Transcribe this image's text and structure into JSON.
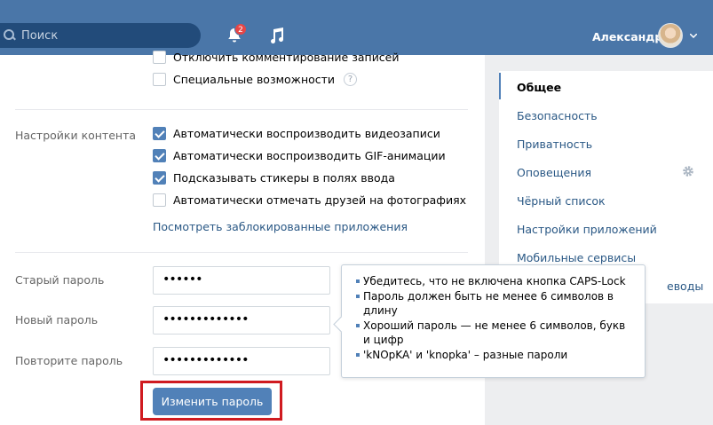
{
  "header": {
    "search_placeholder": "Поиск",
    "notifications_count": "2",
    "user_name": "Александр"
  },
  "privacy_options": [
    {
      "label": "Отключить комментирование записей",
      "checked": false
    },
    {
      "label": "Специальные возможности",
      "checked": false
    }
  ],
  "help_symbol": "?",
  "content_settings": {
    "title": "Настройки контента",
    "options": [
      {
        "label": "Автоматически воспроизводить видеозаписи",
        "checked": true
      },
      {
        "label": "Автоматически воспроизводить GIF-анимации",
        "checked": true
      },
      {
        "label": "Подсказывать стикеры в полях ввода",
        "checked": true
      },
      {
        "label": "Автоматически отмечать друзей на фотографиях",
        "checked": false
      }
    ],
    "blocked_apps_link": "Посмотреть заблокированные приложения"
  },
  "password": {
    "old_label": "Старый пароль",
    "old_value": "••••••",
    "new_label": "Новый пароль",
    "new_value": "•••••••••••••",
    "repeat_label": "Повторите пароль",
    "repeat_value": "•••••••••••••",
    "submit_label": "Изменить пароль"
  },
  "tooltip": {
    "tips": [
      "Убедитесь, что не включена кнопка CAPS-Lock",
      "Пароль должен быть не менее 6 символов в длину",
      "Хороший пароль — не менее 6 символов, букв и цифр",
      "'kNOpKA' и 'knopka' – разные пароли"
    ]
  },
  "menu": {
    "items": [
      {
        "label": "Общее",
        "active": true
      },
      {
        "label": "Безопасность"
      },
      {
        "label": "Приватность"
      },
      {
        "label": "Оповещения"
      },
      {
        "label": "Чёрный список"
      },
      {
        "label": "Настройки приложений"
      },
      {
        "label": "Мобильные сервисы"
      },
      {
        "label": "Платежи и переводы"
      }
    ],
    "visible_suffix": "еводы"
  },
  "colors": {
    "header": "#4a76a8",
    "accent": "#5181b8",
    "link": "#2a5885",
    "highlight_border": "#d01b20",
    "badge": "#e64646"
  },
  "icons": [
    "search-icon",
    "bell-icon",
    "music-icon",
    "avatar",
    "chevron-down-icon",
    "gear-icon",
    "help-icon"
  ]
}
